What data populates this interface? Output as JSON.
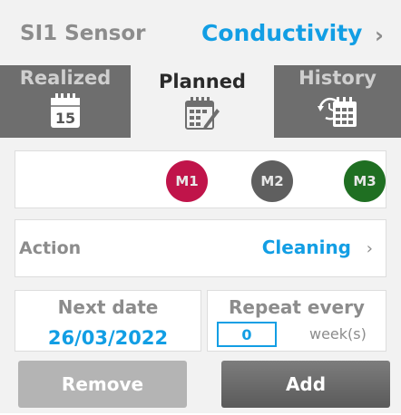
{
  "header": {
    "sensor": "SI1 Sensor",
    "parameter": "Conductivity",
    "chevron_icon": "chevron-right-icon"
  },
  "tabs": [
    {
      "label": "Realized",
      "icon": "calendar-15-icon",
      "icon_text": "15",
      "active": false
    },
    {
      "label": "Planned",
      "icon": "calendar-edit-icon",
      "active": true
    },
    {
      "label": "History",
      "icon": "calendar-history-icon",
      "active": false
    }
  ],
  "maintenance_levels": [
    {
      "label": "M1",
      "color": "#c0144a"
    },
    {
      "label": "M2",
      "color": "#5f5f5f"
    },
    {
      "label": "M3",
      "color": "#1f6f22"
    }
  ],
  "action": {
    "label": "Action",
    "value": "Cleaning"
  },
  "next_date": {
    "label": "Next date",
    "value": "26/03/2022"
  },
  "repeat": {
    "label": "Repeat every",
    "value": "0",
    "unit": "week(s)"
  },
  "buttons": {
    "remove": "Remove",
    "add": "Add"
  },
  "colors": {
    "accent": "#129ee4",
    "tab_inactive": "#6e6e6e",
    "text_muted": "#8c8c8c"
  }
}
